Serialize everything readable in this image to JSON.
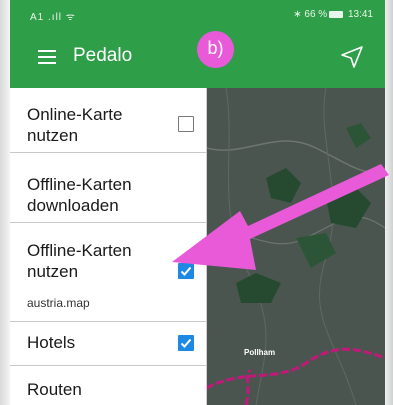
{
  "status_bar": {
    "left": "A1 .ıll ᯤ",
    "bluetooth": "∗",
    "battery": "66 %",
    "time": "13:41"
  },
  "app_bar": {
    "title": "Pedalo",
    "menu_icon": "hamburger-menu-icon",
    "action_icon": "navigation-arrow-icon"
  },
  "annotation": {
    "step_label": "b)",
    "badge_color": "#e85ad8",
    "arrow_color": "#e85ad8"
  },
  "drawer": {
    "items": [
      {
        "label_line1": "Online-Karte",
        "label_line2": "nutzen",
        "checked": false
      },
      {
        "label_line1": "Offline-Karten",
        "label_line2": "downloaden"
      },
      {
        "label_line1": "Offline-Karten",
        "label_line2": "nutzen",
        "checked": true,
        "sub": "austria.map"
      },
      {
        "label_line1": "Hotels",
        "checked": true
      },
      {
        "label_line1": "Routen"
      }
    ]
  },
  "map": {
    "place_label": "Pollham"
  },
  "colors": {
    "primary": "#2e9e49",
    "checkbox": "#1e88e5",
    "route": "#c2187a"
  }
}
